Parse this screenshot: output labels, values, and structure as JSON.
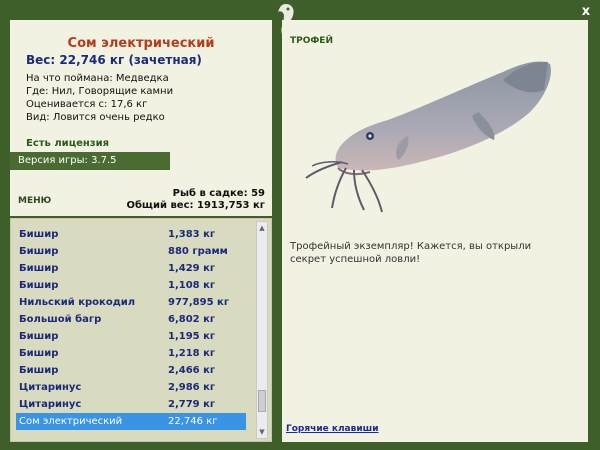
{
  "fish": {
    "name": "Сом электрический",
    "weight_line": "Вес: 22,746 кг (зачетная)",
    "bait": "На что поймана: Медведка",
    "location": "Где: Нил, Говорящие камни",
    "valued_from": "Оценивается с: 17,6 кг",
    "rarity": "Вид: Ловится очень редко"
  },
  "license_label": "Есть лицензия",
  "version_label": "Версия игры: 3.7.5",
  "menu_label": "МЕНЮ",
  "stats": {
    "fish_in_keepnet": "Рыб в садке: 59",
    "total_weight": "Общий вес: 1913,753 кг"
  },
  "catch_list": [
    {
      "name": "Бишир",
      "weight": "1,383 кг"
    },
    {
      "name": "Бишир",
      "weight": "880 грамм"
    },
    {
      "name": "Бишир",
      "weight": "1,429 кг"
    },
    {
      "name": "Бишир",
      "weight": "1,108 кг"
    },
    {
      "name": "Нильский крокодил",
      "weight": "977,895 кг"
    },
    {
      "name": "Большой багр",
      "weight": "6,802 кг"
    },
    {
      "name": "Бишир",
      "weight": "1,195 кг"
    },
    {
      "name": "Бишир",
      "weight": "1,218 кг"
    },
    {
      "name": "Бишир",
      "weight": "2,466 кг"
    },
    {
      "name": "Цитаринус",
      "weight": "2,986 кг"
    },
    {
      "name": "Цитаринус",
      "weight": "2,779 кг"
    },
    {
      "name": "Сом электрический",
      "weight": "22,746 кг",
      "selected": true
    }
  ],
  "trophy_label": "ТРОФЕЙ",
  "trophy_text": "Трофейный экземпляр! Кажется, вы открыли секрет успешной ловли!",
  "hotkeys_label": "Горячие клавиши",
  "close_label": "x",
  "colors": {
    "frame": "#3f5f2a",
    "panel": "#f2f2e2",
    "list_bg": "#d9dbc0",
    "title_red": "#b53c1a",
    "list_text": "#1b2a7a",
    "selection": "#3a94e6"
  }
}
